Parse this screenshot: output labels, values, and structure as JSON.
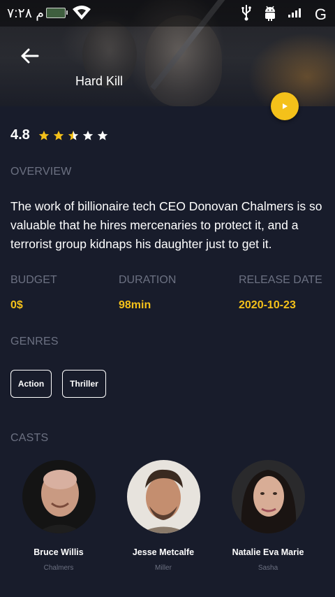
{
  "status_bar": {
    "time": "۷:۲۸ م",
    "network": "G"
  },
  "movie": {
    "title": "Hard Kill",
    "rating": "4.8",
    "stars_filled": 2.5,
    "stars_total": 5
  },
  "overview": {
    "label": "OVERVIEW",
    "text": "The work of billionaire tech CEO Donovan Chalmers is so valuable that he hires mercenaries to protect it, and a terrorist group kidnaps his daughter just to get it."
  },
  "info": {
    "budget_label": "BUDGET",
    "budget_value": "0$",
    "duration_label": "DURATION",
    "duration_value": "98min",
    "release_label": "RELEASE DATE",
    "release_value": "2020-10-23"
  },
  "genres": {
    "label": "GENRES",
    "items": [
      "Action",
      "Thriller"
    ]
  },
  "casts": {
    "label": "CASTS",
    "items": [
      {
        "name": "Bruce Willis",
        "role": "Chalmers"
      },
      {
        "name": "Jesse Metcalfe",
        "role": "Miller"
      },
      {
        "name": "Natalie Eva Marie",
        "role": "Sasha"
      }
    ]
  },
  "icons": {
    "back": "arrow-left-icon",
    "play": "play-icon",
    "star": "star-icon"
  },
  "colors": {
    "background": "#181c2b",
    "accent": "#f4c11a",
    "muted": "#6c7182",
    "star_empty": "#ffffff"
  }
}
